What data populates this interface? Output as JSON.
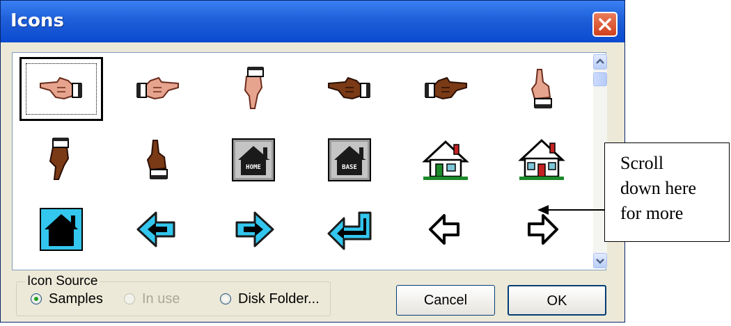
{
  "dialog": {
    "title": "Icons",
    "close_icon": "close-icon"
  },
  "icons": [
    {
      "name": "hand-pointing-left-light-icon"
    },
    {
      "name": "hand-pointing-right-light-icon"
    },
    {
      "name": "hand-pointing-down-light-icon"
    },
    {
      "name": "hand-pointing-left-dark-icon"
    },
    {
      "name": "hand-pointing-right-dark-icon"
    },
    {
      "name": "hand-pointing-up-light-icon"
    },
    {
      "name": "hand-pointing-down-dark-icon"
    },
    {
      "name": "hand-pointing-up-dark-icon"
    },
    {
      "name": "home-gray-icon",
      "label": "HOME"
    },
    {
      "name": "base-gray-icon",
      "label": "BASE"
    },
    {
      "name": "house-green-door-icon"
    },
    {
      "name": "house-red-door-icon"
    },
    {
      "name": "home-cyan-icon"
    },
    {
      "name": "arrow-left-cyan-icon"
    },
    {
      "name": "arrow-right-cyan-icon"
    },
    {
      "name": "arrow-return-cyan-icon"
    },
    {
      "name": "arrow-left-outline-icon"
    },
    {
      "name": "arrow-right-outline-icon"
    }
  ],
  "selected_icon": "hand-pointing-left-light-icon",
  "icon_source": {
    "label": "Icon Source",
    "options": [
      {
        "label": "Samples",
        "selected": true,
        "enabled": true
      },
      {
        "label": "In use",
        "selected": false,
        "enabled": false
      },
      {
        "label": "Disk Folder...",
        "selected": false,
        "enabled": true
      }
    ]
  },
  "buttons": {
    "cancel": "Cancel",
    "ok": "OK"
  },
  "annotation": {
    "lines": [
      "Scroll",
      "down here",
      "for more"
    ]
  },
  "colors": {
    "title_bar": "#1f5fd8",
    "close_button": "#d0401d",
    "dialog_bg": "#ece9d8",
    "cyan_icon": "#33c6ee"
  }
}
